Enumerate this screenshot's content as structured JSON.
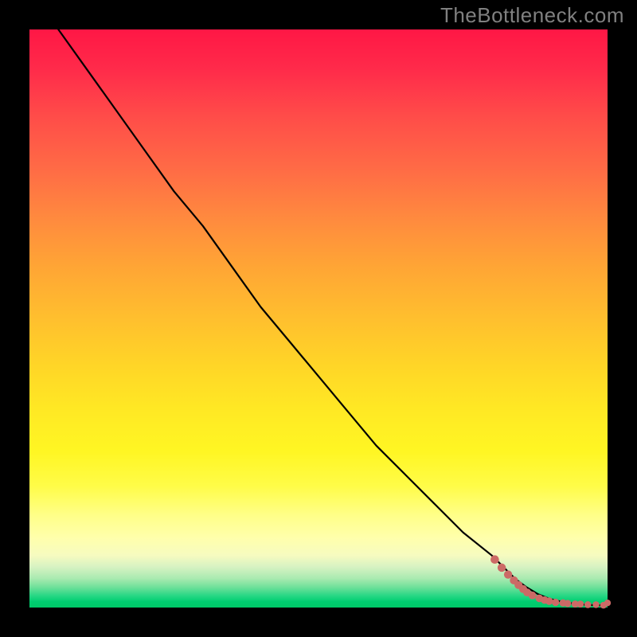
{
  "watermark": "TheBottleneck.com",
  "chart_data": {
    "type": "line",
    "title": "",
    "xlabel": "",
    "ylabel": "",
    "xlim": [
      0,
      100
    ],
    "ylim": [
      0,
      100
    ],
    "grid": false,
    "legend": false,
    "background": {
      "orientation": "vertical",
      "stops": [
        {
          "pos": 0.0,
          "color": "#ff1745"
        },
        {
          "pos": 0.5,
          "color": "#ffbf2e"
        },
        {
          "pos": 0.8,
          "color": "#fffc48"
        },
        {
          "pos": 0.92,
          "color": "#d6f2c2"
        },
        {
          "pos": 1.0,
          "color": "#00c968"
        }
      ]
    },
    "series": [
      {
        "name": "bottleneck-curve",
        "kind": "line",
        "color": "#000000",
        "x": [
          5,
          10,
          15,
          20,
          25,
          30,
          35,
          40,
          45,
          50,
          55,
          60,
          65,
          70,
          75,
          80,
          82,
          84,
          86,
          88,
          90,
          92,
          94,
          96,
          98,
          100
        ],
        "y": [
          100,
          93,
          86,
          79,
          72,
          66,
          59,
          52,
          46,
          40,
          34,
          28,
          23,
          18,
          13,
          9,
          7,
          5,
          3.5,
          2.3,
          1.5,
          1.0,
          0.7,
          0.5,
          0.4,
          0.4
        ]
      },
      {
        "name": "tail-points",
        "kind": "scatter",
        "color": "#cc6a66",
        "x": [
          80.5,
          81.7,
          82.8,
          83.8,
          84.6,
          85.4,
          86.1,
          87.0,
          88.2,
          89.1,
          89.9,
          91.0,
          92.3,
          93.1,
          94.4,
          95.3,
          96.6,
          98.0,
          99.3,
          100.0
        ],
        "y": [
          8.3,
          6.9,
          5.7,
          4.7,
          3.9,
          3.2,
          2.6,
          2.1,
          1.6,
          1.3,
          1.1,
          0.9,
          0.8,
          0.7,
          0.6,
          0.6,
          0.5,
          0.5,
          0.4,
          0.8
        ]
      }
    ]
  },
  "colors": {
    "frame": "#000000",
    "watermark": "#808080",
    "curve": "#000000",
    "points": "#cc6a66"
  }
}
